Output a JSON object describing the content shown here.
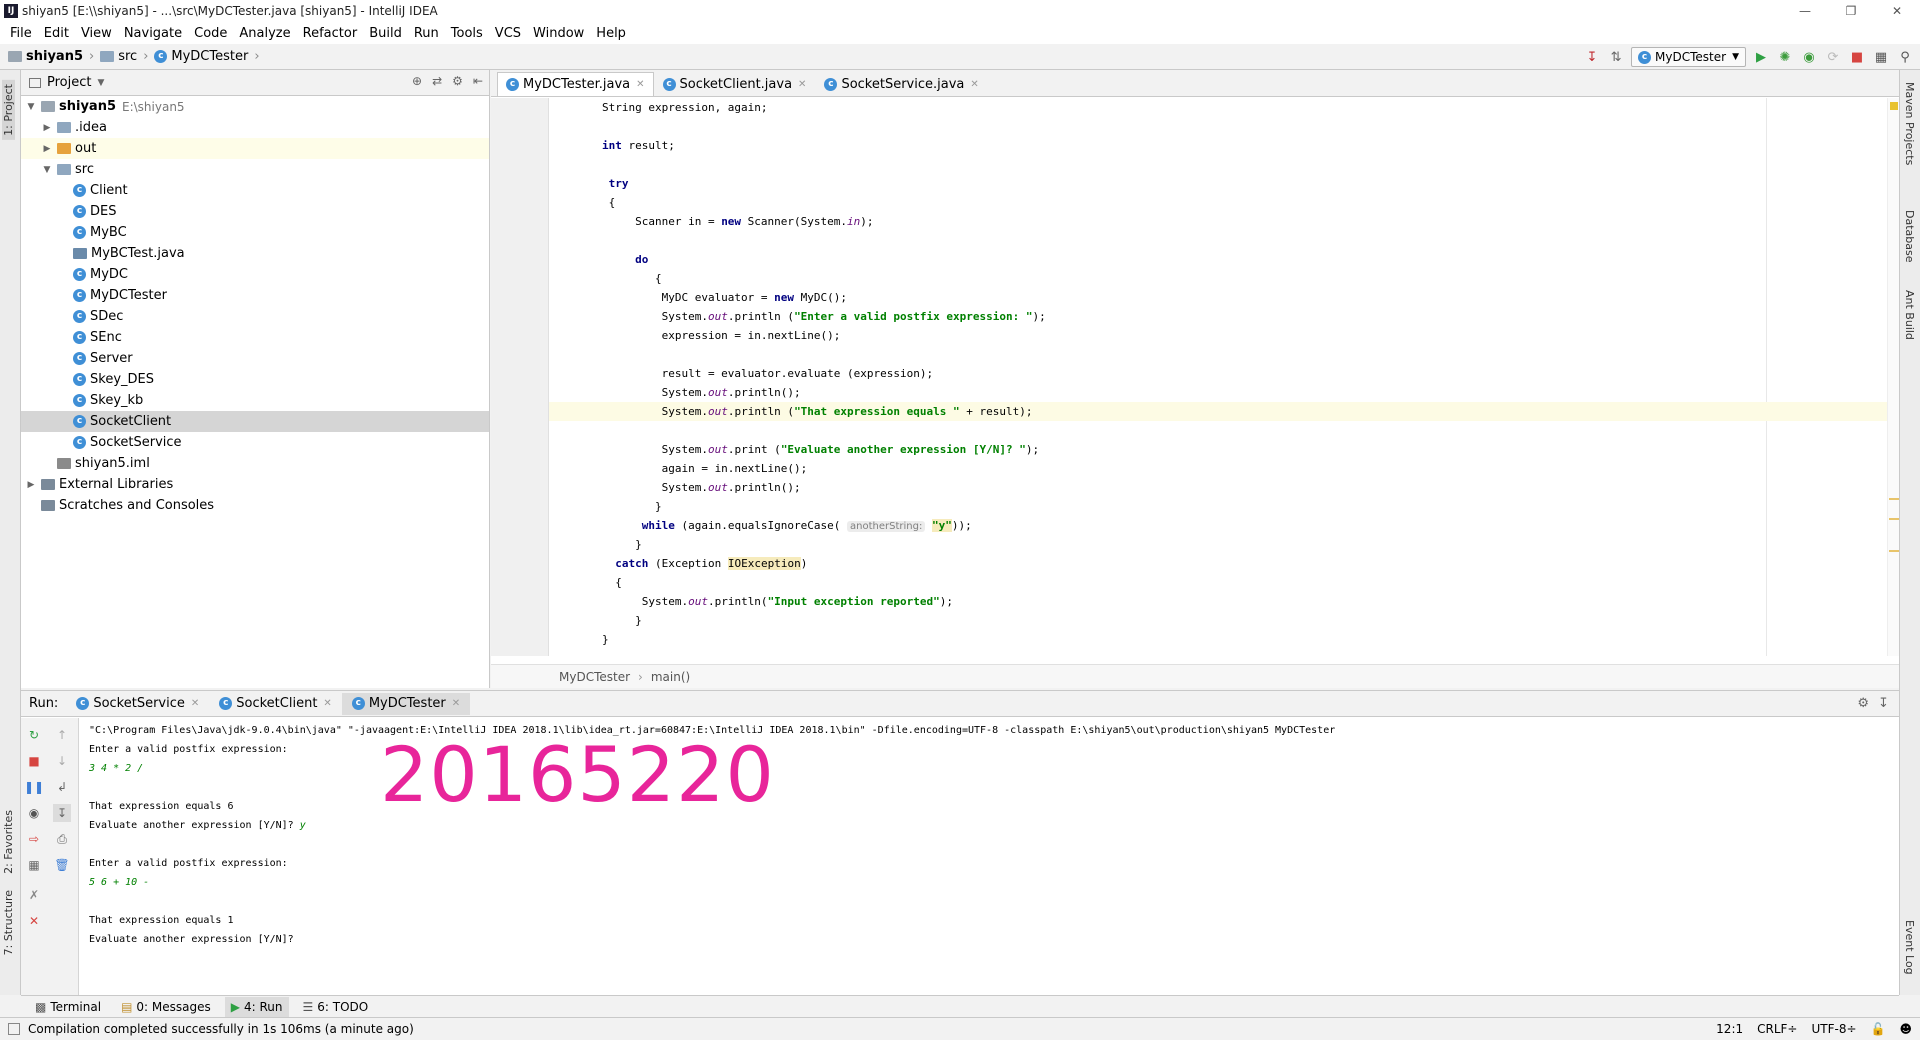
{
  "window": {
    "title": "shiyan5 [E:\\\\shiyan5] - ...\\src\\MyDCTester.java [shiyan5] - IntelliJ IDEA",
    "app_icon": "IJ"
  },
  "menu": [
    "File",
    "Edit",
    "View",
    "Navigate",
    "Code",
    "Analyze",
    "Refactor",
    "Build",
    "Run",
    "Tools",
    "VCS",
    "Window",
    "Help"
  ],
  "breadcrumb": [
    "shiyan5",
    "src",
    "MyDCTester"
  ],
  "run_config": "MyDCTester",
  "left_tabs": [
    "1: Project",
    "2: Favorites",
    "7: Structure"
  ],
  "right_tabs": [
    "Maven Projects",
    "Database",
    "Ant Build",
    "Event Log"
  ],
  "project": {
    "header": "Project",
    "tree": [
      {
        "label": "shiyan5",
        "extra": "E:\\shiyan5",
        "depth": 0,
        "arrow": "down",
        "icon": "module-folder-icon"
      },
      {
        "label": ".idea",
        "depth": 1,
        "arrow": "right",
        "icon": "folder-icon"
      },
      {
        "label": "out",
        "depth": 1,
        "arrow": "right",
        "icon": "folder-orange-icon"
      },
      {
        "label": "src",
        "depth": 1,
        "arrow": "down",
        "icon": "folder-icon"
      },
      {
        "label": "Client",
        "depth": 2,
        "icon": "class-icon"
      },
      {
        "label": "DES",
        "depth": 2,
        "icon": "class-icon"
      },
      {
        "label": "MyBC",
        "depth": 2,
        "icon": "class-icon"
      },
      {
        "label": "MyBCTest.java",
        "depth": 2,
        "icon": "java-file-icon"
      },
      {
        "label": "MyDC",
        "depth": 2,
        "icon": "class-icon"
      },
      {
        "label": "MyDCTester",
        "depth": 2,
        "icon": "class-icon"
      },
      {
        "label": "SDec",
        "depth": 2,
        "icon": "class-icon"
      },
      {
        "label": "SEnc",
        "depth": 2,
        "icon": "class-icon"
      },
      {
        "label": "Server",
        "depth": 2,
        "icon": "class-icon"
      },
      {
        "label": "Skey_DES",
        "depth": 2,
        "icon": "class-icon"
      },
      {
        "label": "Skey_kb",
        "depth": 2,
        "icon": "class-icon"
      },
      {
        "label": "SocketClient",
        "depth": 2,
        "icon": "class-icon"
      },
      {
        "label": "SocketService",
        "depth": 2,
        "icon": "class-icon"
      },
      {
        "label": "shiyan5.iml",
        "depth": 1,
        "icon": "iml-file-icon"
      },
      {
        "label": "External Libraries",
        "depth": 0,
        "arrow": "right",
        "icon": "library-icon"
      },
      {
        "label": "Scratches and Consoles",
        "depth": 0,
        "icon": "scratches-icon"
      }
    ]
  },
  "editor": {
    "tabs": [
      "MyDCTester.java",
      "SocketClient.java",
      "SocketService.java"
    ],
    "active_tab": "MyDCTester.java",
    "current_line": 23,
    "breadcrumb": [
      "MyDCTester",
      "main()"
    ]
  },
  "run": {
    "label": "Run:",
    "tabs": [
      "SocketService",
      "SocketClient",
      "MyDCTester"
    ],
    "active_tab": "MyDCTester",
    "console": [
      {
        "text": "\"C:\\Program Files\\Java\\jdk-9.0.4\\bin\\java\" \"-javaagent:E:\\IntelliJ IDEA 2018.1\\lib\\idea_rt.jar=60847:E:\\IntelliJ IDEA 2018.1\\bin\" -Dfile.encoding=UTF-8 -classpath E:\\shiyan5\\out\\production\\shiyan5 MyDCTester",
        "type": "out"
      },
      {
        "text": "Enter a valid postfix expression:",
        "type": "out"
      },
      {
        "text": "3 4 * 2 /",
        "type": "input"
      },
      {
        "text": "",
        "type": "out"
      },
      {
        "text": "That expression equals 6",
        "type": "out"
      },
      {
        "text": "Evaluate another expression [Y/N]? ",
        "type": "out",
        "input": "y"
      },
      {
        "text": "",
        "type": "out"
      },
      {
        "text": "Enter a valid postfix expression:",
        "type": "out"
      },
      {
        "text": "5 6 + 10 -",
        "type": "input"
      },
      {
        "text": "",
        "type": "out"
      },
      {
        "text": "That expression equals 1",
        "type": "out"
      },
      {
        "text": "Evaluate another expression [Y/N]?",
        "type": "out"
      }
    ]
  },
  "overlay_text": "20165220",
  "bottom_tabs": [
    "Terminal",
    "0: Messages",
    "4: Run",
    "6: TODO"
  ],
  "bottom_active": "4: Run",
  "status": {
    "message": "Compilation completed successfully in 1s 106ms (a minute ago)",
    "position": "12:1",
    "line_sep": "CRLF÷",
    "encoding": "UTF-8÷"
  },
  "colors": {
    "keyword": "#000080",
    "string": "#008000",
    "overlay": "#e8259a",
    "current_line": "#fdfbe4"
  }
}
